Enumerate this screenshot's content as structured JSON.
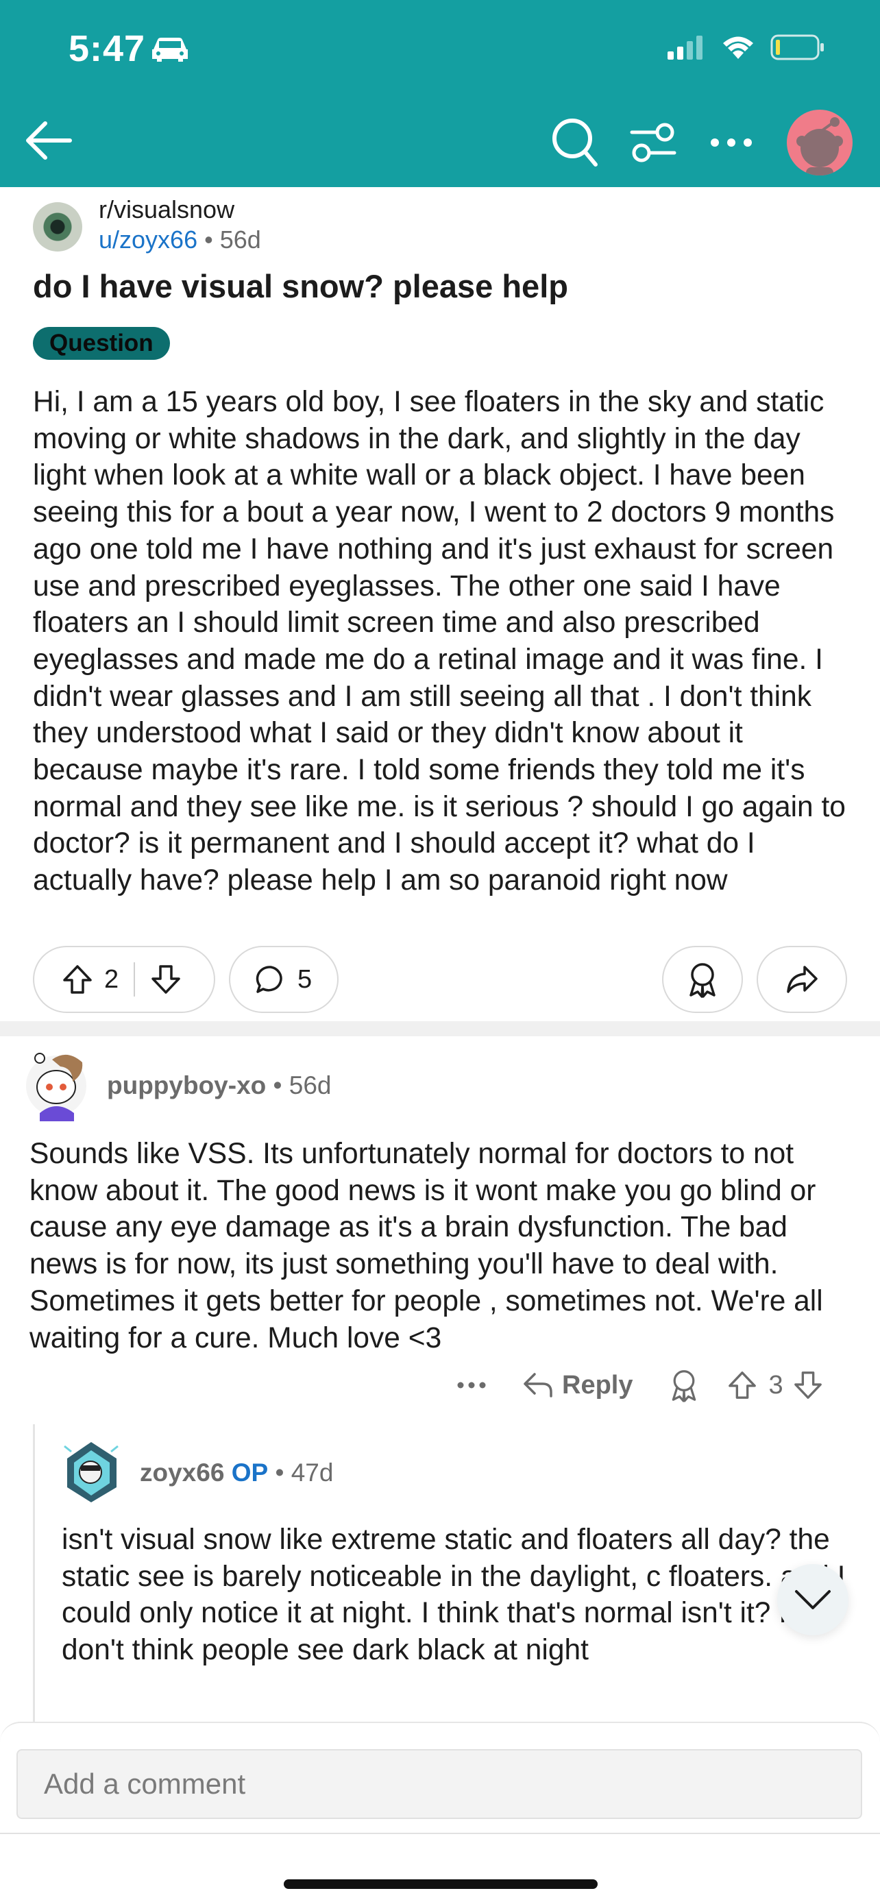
{
  "status_bar": {
    "time": "5:47"
  },
  "post": {
    "subreddit": "r/visualsnow",
    "author": "u/zoyx66",
    "age": "56d",
    "title": "do I have visual snow? please help",
    "flair": "Question",
    "body": "Hi, I am a 15 years old boy, I see floaters in the sky and static moving or white shadows in the dark, and slightly in the day light when look at a white wall or a black object. I have been seeing this for a bout a year now, I went to 2 doctors 9 months ago one told me I have nothing and it's just exhaust for screen use and prescribed eyeglasses. The other one said I have floaters an I should limit screen time and also prescribed eyeglasses and made me do a retinal image and it was fine. I didn't wear glasses and I am still seeing all that . I don't think they understood what I said or they didn't know about it because maybe it's rare. I told some friends they told me it's normal and they see like me. is it serious ? should I go again to doctor? is it permanent and I should accept it? what do I actually have? please help I am so paranoid right now",
    "votes": "2",
    "comments": "5"
  },
  "comments": [
    {
      "author": "puppyboy-xo",
      "age": "56d",
      "body": "Sounds like VSS. Its unfortunately normal for doctors to not know about it. The good news is it wont make you go blind or cause any eye damage as it's a brain dysfunction. The bad news is for now, its just something you'll have to deal with. Sometimes it gets better for people , sometimes not. We're all waiting for a cure. Much love <3",
      "reply_label": "Reply",
      "votes": "3"
    },
    {
      "author": "zoyx66",
      "badge": "OP",
      "age": "47d",
      "body": "isn't visual snow like extreme static and floaters all day? the static see  is barely noticeable in the daylight, c floaters.  and I could only notice it at night.  I think that's normal isn't it? I don't think people see dark black at night"
    }
  ],
  "composer": {
    "placeholder": "Add a comment"
  },
  "colors": {
    "header": "#149fa1",
    "link": "#1a73c8",
    "flair": "#0d6e6e",
    "avatar_bg": "#f07c89"
  }
}
